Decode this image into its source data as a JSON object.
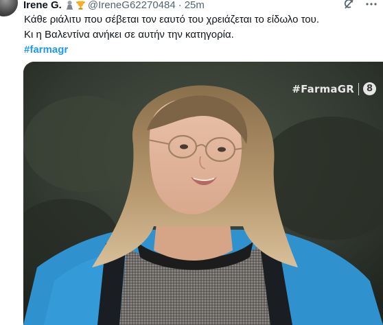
{
  "tweet": {
    "author_name": "Irene G.",
    "author_handle": "@IreneG62270484",
    "separator": "·",
    "timestamp": "25m",
    "badges": [
      "gray-figure-icon",
      "trophy-icon"
    ],
    "text_lines": [
      "Κάθε ριάλιτυ που σέβεται τον εαυτό του χρειάζεται το είδωλο του.",
      "Κι η Βαλεντίνα ανήκει σε αυτήν την κατηγορία."
    ],
    "hashtag": "#farmagr",
    "actions": [
      "grok-icon",
      "more-icon"
    ]
  },
  "media": {
    "overlay_tag": "#FarmaGR",
    "channel_number": "8",
    "colors": {
      "jacket": "#2f92cf",
      "background": "#2d332c"
    }
  },
  "colors": {
    "link": "#1d9bf0",
    "secondary": "#536471",
    "text": "#0f1419"
  }
}
